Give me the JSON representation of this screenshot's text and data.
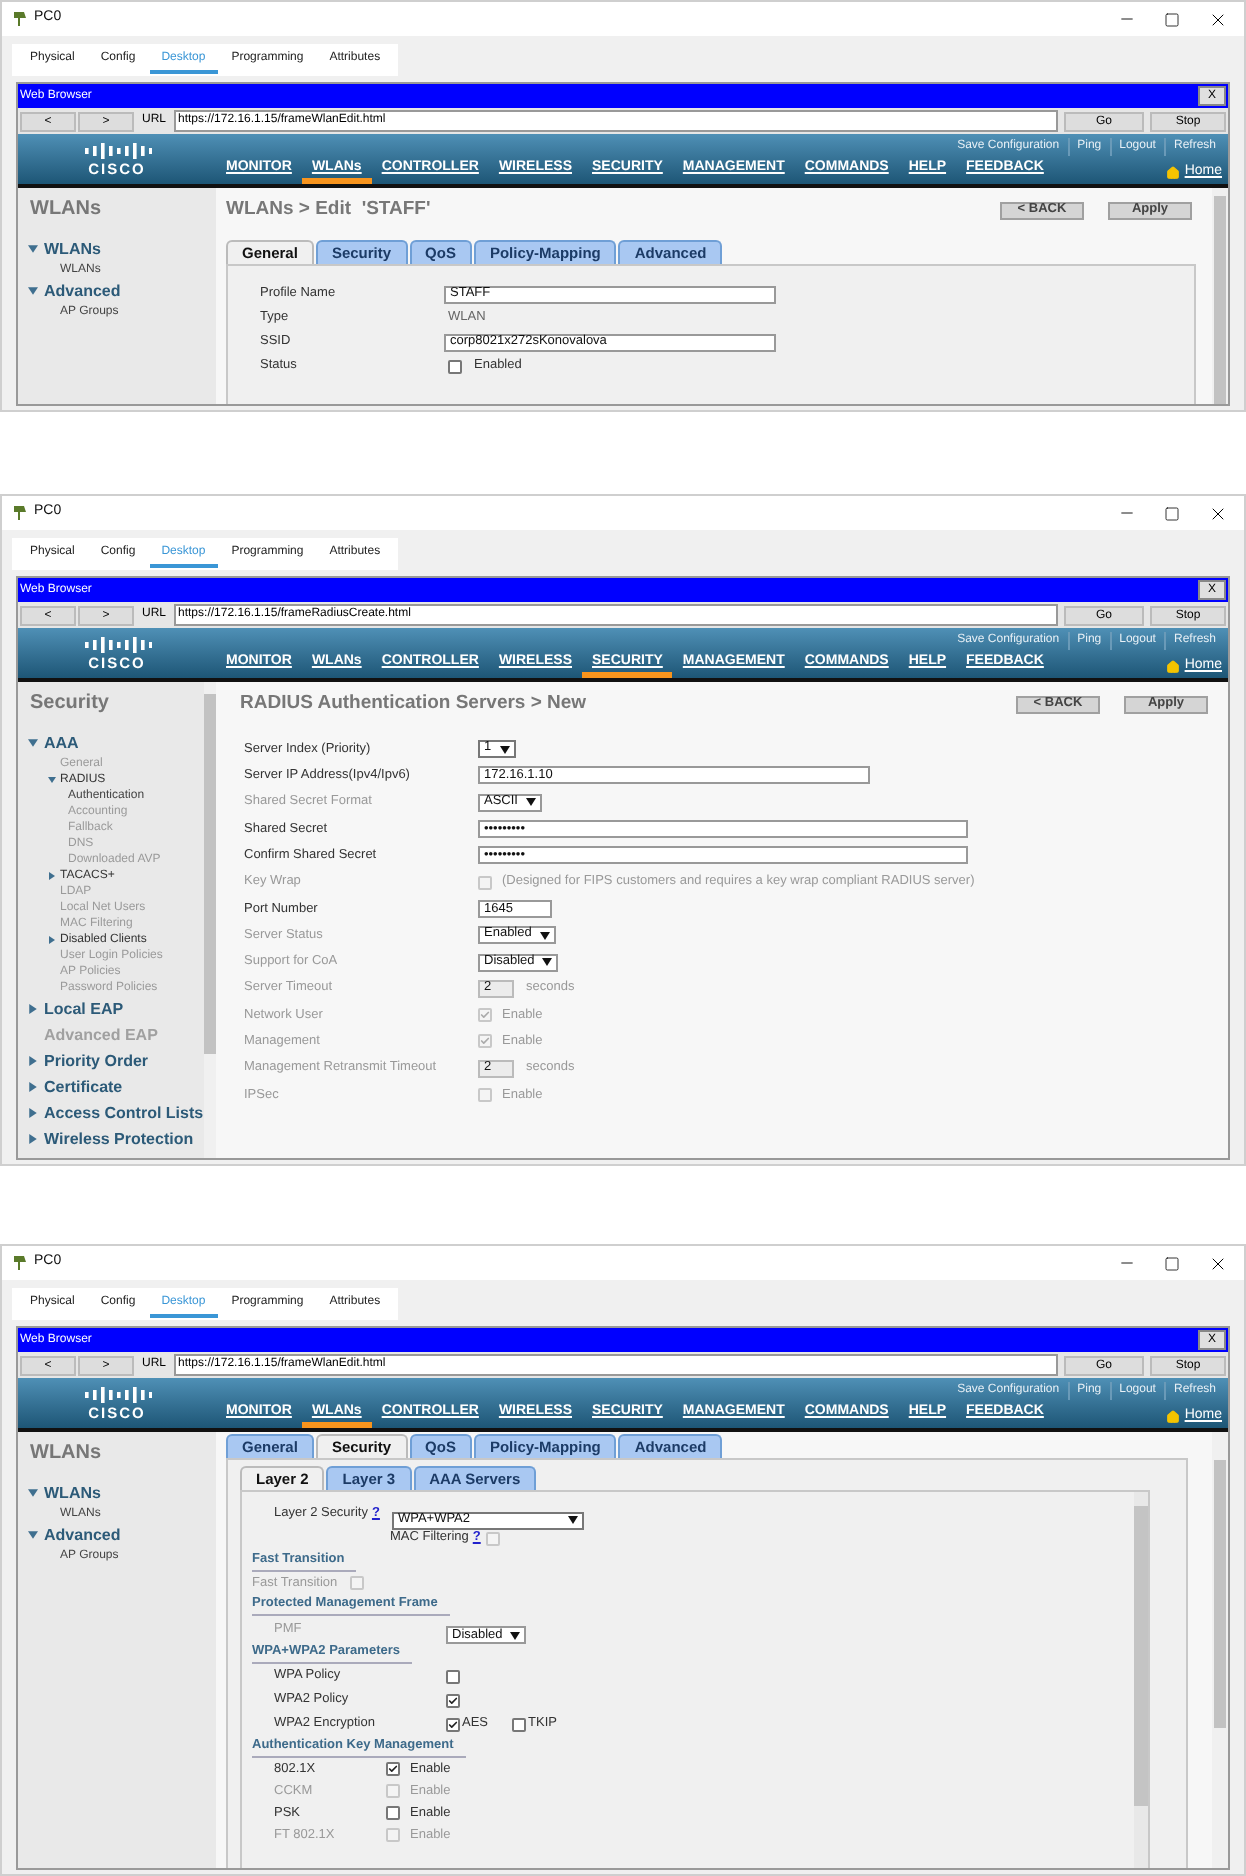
{
  "windows": [
    {
      "kind": "wlan_general",
      "title": "PC0",
      "tabs": [
        {
          "label": "Physical",
          "selected": false
        },
        {
          "label": "Config",
          "selected": false
        },
        {
          "label": "Desktop",
          "selected": true
        },
        {
          "label": "Programming",
          "selected": false
        },
        {
          "label": "Attributes",
          "selected": false
        }
      ],
      "browser": {
        "title": "Web Browser",
        "close": "X",
        "back": "<",
        "forward": ">",
        "url_label": "URL",
        "url": "https://172.16.1.15/frameWlanEdit.html",
        "go": "Go",
        "stop": "Stop"
      },
      "header": {
        "logo": "CISCO",
        "links": [
          "Save Configuration",
          "Ping",
          "Logout",
          "Refresh"
        ],
        "home": "Home",
        "menu": [
          {
            "label": "MONITOR",
            "selected": false
          },
          {
            "label": "WLANs",
            "selected": true
          },
          {
            "label": "CONTROLLER",
            "selected": false
          },
          {
            "label": "WIRELESS",
            "selected": false
          },
          {
            "label": "SECURITY",
            "selected": false
          },
          {
            "label": "MANAGEMENT",
            "selected": false
          },
          {
            "label": "COMMANDS",
            "selected": false
          },
          {
            "label": "HELP",
            "selected": false
          },
          {
            "label": "FEEDBACK",
            "selected": false
          }
        ]
      },
      "sidebar": {
        "title": "WLANs",
        "items": [
          {
            "label": "WLANs",
            "kind": "section",
            "expanded": true,
            "disabled": false,
            "children": [
              {
                "label": "WLANs",
                "kind": "item",
                "disabled": false
              }
            ]
          },
          {
            "label": "Advanced",
            "kind": "section",
            "expanded": true,
            "disabled": false,
            "children": [
              {
                "label": "AP Groups",
                "kind": "item",
                "disabled": false
              }
            ]
          }
        ]
      },
      "page": {
        "heading": "WLANs > Edit  'STAFF'",
        "buttons": [
          "< BACK",
          "Apply"
        ],
        "tabs": [
          {
            "label": "General",
            "selected": true
          },
          {
            "label": "Security",
            "selected": false
          },
          {
            "label": "QoS",
            "selected": false
          },
          {
            "label": "Policy-Mapping",
            "selected": false
          },
          {
            "label": "Advanced",
            "selected": false
          }
        ],
        "fields": [
          {
            "label": "Profile Name",
            "kind": "input",
            "value": "STAFF"
          },
          {
            "label": "Type",
            "kind": "text",
            "value": "WLAN"
          },
          {
            "label": "SSID",
            "kind": "input",
            "value": "corp8021x272sKonovalova"
          },
          {
            "label": "Status",
            "kind": "checkbox",
            "checked": false,
            "value": "Enabled"
          }
        ]
      }
    },
    {
      "kind": "radius_new",
      "title": "PC0",
      "tabs": [
        {
          "label": "Physical",
          "selected": false
        },
        {
          "label": "Config",
          "selected": false
        },
        {
          "label": "Desktop",
          "selected": true
        },
        {
          "label": "Programming",
          "selected": false
        },
        {
          "label": "Attributes",
          "selected": false
        }
      ],
      "browser": {
        "title": "Web Browser",
        "close": "X",
        "back": "<",
        "forward": ">",
        "url_label": "URL",
        "url": "https://172.16.1.15/frameRadiusCreate.html",
        "go": "Go",
        "stop": "Stop"
      },
      "header": {
        "logo": "CISCO",
        "links": [
          "Save Configuration",
          "Ping",
          "Logout",
          "Refresh"
        ],
        "home": "Home",
        "menu": [
          {
            "label": "MONITOR",
            "selected": false
          },
          {
            "label": "WLANs",
            "selected": false
          },
          {
            "label": "CONTROLLER",
            "selected": false
          },
          {
            "label": "WIRELESS",
            "selected": false
          },
          {
            "label": "SECURITY",
            "selected": true
          },
          {
            "label": "MANAGEMENT",
            "selected": false
          },
          {
            "label": "COMMANDS",
            "selected": false
          },
          {
            "label": "HELP",
            "selected": false
          },
          {
            "label": "FEEDBACK",
            "selected": false
          }
        ]
      },
      "sidebar": {
        "title": "Security",
        "items": [
          {
            "label": "AAA",
            "kind": "section",
            "expanded": true,
            "disabled": false,
            "children": [
              {
                "label": "General",
                "kind": "item",
                "disabled": true
              },
              {
                "label": "RADIUS",
                "kind": "group",
                "expanded": true,
                "disabled": false,
                "children": [
                  {
                    "label": "Authentication",
                    "kind": "item",
                    "disabled": false
                  },
                  {
                    "label": "Accounting",
                    "kind": "item",
                    "disabled": true
                  },
                  {
                    "label": "Fallback",
                    "kind": "item",
                    "disabled": true
                  },
                  {
                    "label": "DNS",
                    "kind": "item",
                    "disabled": true
                  },
                  {
                    "label": "Downloaded AVP",
                    "kind": "item",
                    "disabled": true
                  }
                ]
              },
              {
                "label": "TACACS+",
                "kind": "group",
                "expanded": false,
                "disabled": false
              },
              {
                "label": "LDAP",
                "kind": "item",
                "disabled": true
              },
              {
                "label": "Local Net Users",
                "kind": "item",
                "disabled": true
              },
              {
                "label": "MAC Filtering",
                "kind": "item",
                "disabled": true
              },
              {
                "label": "Disabled Clients",
                "kind": "group",
                "expanded": false,
                "disabled": false
              },
              {
                "label": "User Login Policies",
                "kind": "item",
                "disabled": true
              },
              {
                "label": "AP Policies",
                "kind": "item",
                "disabled": true
              },
              {
                "label": "Password Policies",
                "kind": "item",
                "disabled": true
              }
            ]
          },
          {
            "label": "Local EAP",
            "kind": "section",
            "expanded": false,
            "disabled": false
          },
          {
            "label": "Advanced EAP",
            "kind": "heading",
            "disabled": true
          },
          {
            "label": "Priority Order",
            "kind": "section",
            "expanded": false,
            "disabled": false
          },
          {
            "label": "Certificate",
            "kind": "section",
            "expanded": false,
            "disabled": false
          },
          {
            "label": "Access Control Lists",
            "kind": "section",
            "expanded": false,
            "disabled": false
          },
          {
            "label": "Wireless Protection",
            "kind": "section",
            "expanded": false,
            "disabled": false
          }
        ]
      },
      "page": {
        "heading": "RADIUS Authentication Servers > New",
        "buttons": [
          "< BACK",
          "Apply"
        ],
        "rows": [
          {
            "label": "Server Index (Priority)",
            "kind": "select",
            "value": "1",
            "disabled": false
          },
          {
            "label": "Server IP Address(Ipv4/Ipv6)",
            "kind": "address",
            "value": "172.16.1.10",
            "disabled": false
          },
          {
            "label": "Shared Secret Format",
            "kind": "select",
            "value": "ASCII",
            "disabled": true
          },
          {
            "label": "Shared Secret",
            "kind": "secret",
            "value": "•••••••••",
            "disabled": false
          },
          {
            "label": "Confirm Shared Secret",
            "kind": "secret",
            "value": "•••••••••",
            "disabled": false
          },
          {
            "label": "Key Wrap",
            "kind": "checkbox",
            "checked": false,
            "value": "(Designed for FIPS customers and requires a key wrap compliant RADIUS server)",
            "disabled": true
          },
          {
            "label": "Port Number",
            "kind": "number",
            "value": "1645",
            "disabled": false
          },
          {
            "label": "Server Status",
            "kind": "select",
            "value": "Enabled",
            "disabled": true
          },
          {
            "label": "Support for CoA",
            "kind": "select",
            "value": "Disabled",
            "disabled": true
          },
          {
            "label": "Server Timeout",
            "kind": "timeout",
            "value": "2",
            "suffix": "seconds",
            "disabled": true
          },
          {
            "label": "Network User",
            "kind": "checkbox",
            "checked": true,
            "value": "Enable",
            "disabled": true
          },
          {
            "label": "Management",
            "kind": "checkbox",
            "checked": true,
            "value": "Enable",
            "disabled": true
          },
          {
            "label": "Management Retransmit Timeout",
            "kind": "timeout",
            "value": "2",
            "suffix": "seconds",
            "disabled": true
          },
          {
            "label": "IPSec",
            "kind": "checkbox",
            "checked": false,
            "value": "Enable",
            "disabled": true
          }
        ]
      }
    },
    {
      "kind": "wlan_security",
      "title": "PC0",
      "tabs": [
        {
          "label": "Physical",
          "selected": false
        },
        {
          "label": "Config",
          "selected": false
        },
        {
          "label": "Desktop",
          "selected": true
        },
        {
          "label": "Programming",
          "selected": false
        },
        {
          "label": "Attributes",
          "selected": false
        }
      ],
      "browser": {
        "title": "Web Browser",
        "close": "X",
        "back": "<",
        "forward": ">",
        "url_label": "URL",
        "url": "https://172.16.1.15/frameWlanEdit.html",
        "go": "Go",
        "stop": "Stop"
      },
      "header": {
        "logo": "CISCO",
        "links": [
          "Save Configuration",
          "Ping",
          "Logout",
          "Refresh"
        ],
        "home": "Home",
        "menu": [
          {
            "label": "MONITOR",
            "selected": false
          },
          {
            "label": "WLANs",
            "selected": true
          },
          {
            "label": "CONTROLLER",
            "selected": false
          },
          {
            "label": "WIRELESS",
            "selected": false
          },
          {
            "label": "SECURITY",
            "selected": false
          },
          {
            "label": "MANAGEMENT",
            "selected": false
          },
          {
            "label": "COMMANDS",
            "selected": false
          },
          {
            "label": "HELP",
            "selected": false
          },
          {
            "label": "FEEDBACK",
            "selected": false
          }
        ]
      },
      "sidebar": {
        "title": "WLANs",
        "items": [
          {
            "label": "WLANs",
            "kind": "section",
            "expanded": true,
            "disabled": false,
            "children": [
              {
                "label": "WLANs",
                "kind": "item",
                "disabled": false
              }
            ]
          },
          {
            "label": "Advanced",
            "kind": "section",
            "expanded": true,
            "disabled": false,
            "children": [
              {
                "label": "AP Groups",
                "kind": "item",
                "disabled": false
              }
            ]
          }
        ]
      },
      "page": {
        "tabs": [
          {
            "label": "General",
            "selected": false
          },
          {
            "label": "Security",
            "selected": true
          },
          {
            "label": "QoS",
            "selected": false
          },
          {
            "label": "Policy-Mapping",
            "selected": false
          },
          {
            "label": "Advanced",
            "selected": false
          }
        ],
        "subtabs": [
          {
            "label": "Layer 2",
            "selected": true
          },
          {
            "label": "Layer 3",
            "selected": false
          },
          {
            "label": "AAA Servers",
            "selected": false
          }
        ],
        "rows": [
          {
            "kind": "help_select",
            "label": "Layer 2 Security",
            "help": "?",
            "value": "WPA+WPA2",
            "disabled": false
          },
          {
            "kind": "help_checkbox",
            "label": "MAC Filtering",
            "help": "?",
            "checked": false,
            "disabled": false
          },
          {
            "kind": "section",
            "label": "Fast Transition"
          },
          {
            "kind": "inline_checkbox",
            "label": "Fast Transition",
            "checked": false,
            "disabled": true
          },
          {
            "kind": "section",
            "label": "Protected Management Frame"
          },
          {
            "kind": "select",
            "label": "PMF",
            "value": "Disabled",
            "disabled": true
          },
          {
            "kind": "section",
            "label": "WPA+WPA2 Parameters"
          },
          {
            "kind": "checkbox",
            "label": "WPA Policy",
            "checked": false,
            "disabled": false
          },
          {
            "kind": "checkbox",
            "label": "WPA2 Policy",
            "checked": true,
            "disabled": false
          },
          {
            "kind": "options",
            "label": "WPA2 Encryption",
            "disabled": false,
            "options": [
              {
                "label": "AES",
                "checked": true
              },
              {
                "label": "TKIP",
                "checked": false
              }
            ]
          },
          {
            "kind": "section",
            "label": "Authentication Key Management"
          },
          {
            "kind": "enable",
            "label": "802.1X",
            "checked": true,
            "value": "Enable",
            "disabled": false
          },
          {
            "kind": "enable",
            "label": "CCKM",
            "checked": false,
            "value": "Enable",
            "disabled": true
          },
          {
            "kind": "enable",
            "label": "PSK",
            "checked": false,
            "value": "Enable",
            "disabled": false
          },
          {
            "kind": "enable",
            "label": "FT 802.1X",
            "checked": false,
            "value": "Enable",
            "disabled": true
          }
        ]
      }
    }
  ]
}
